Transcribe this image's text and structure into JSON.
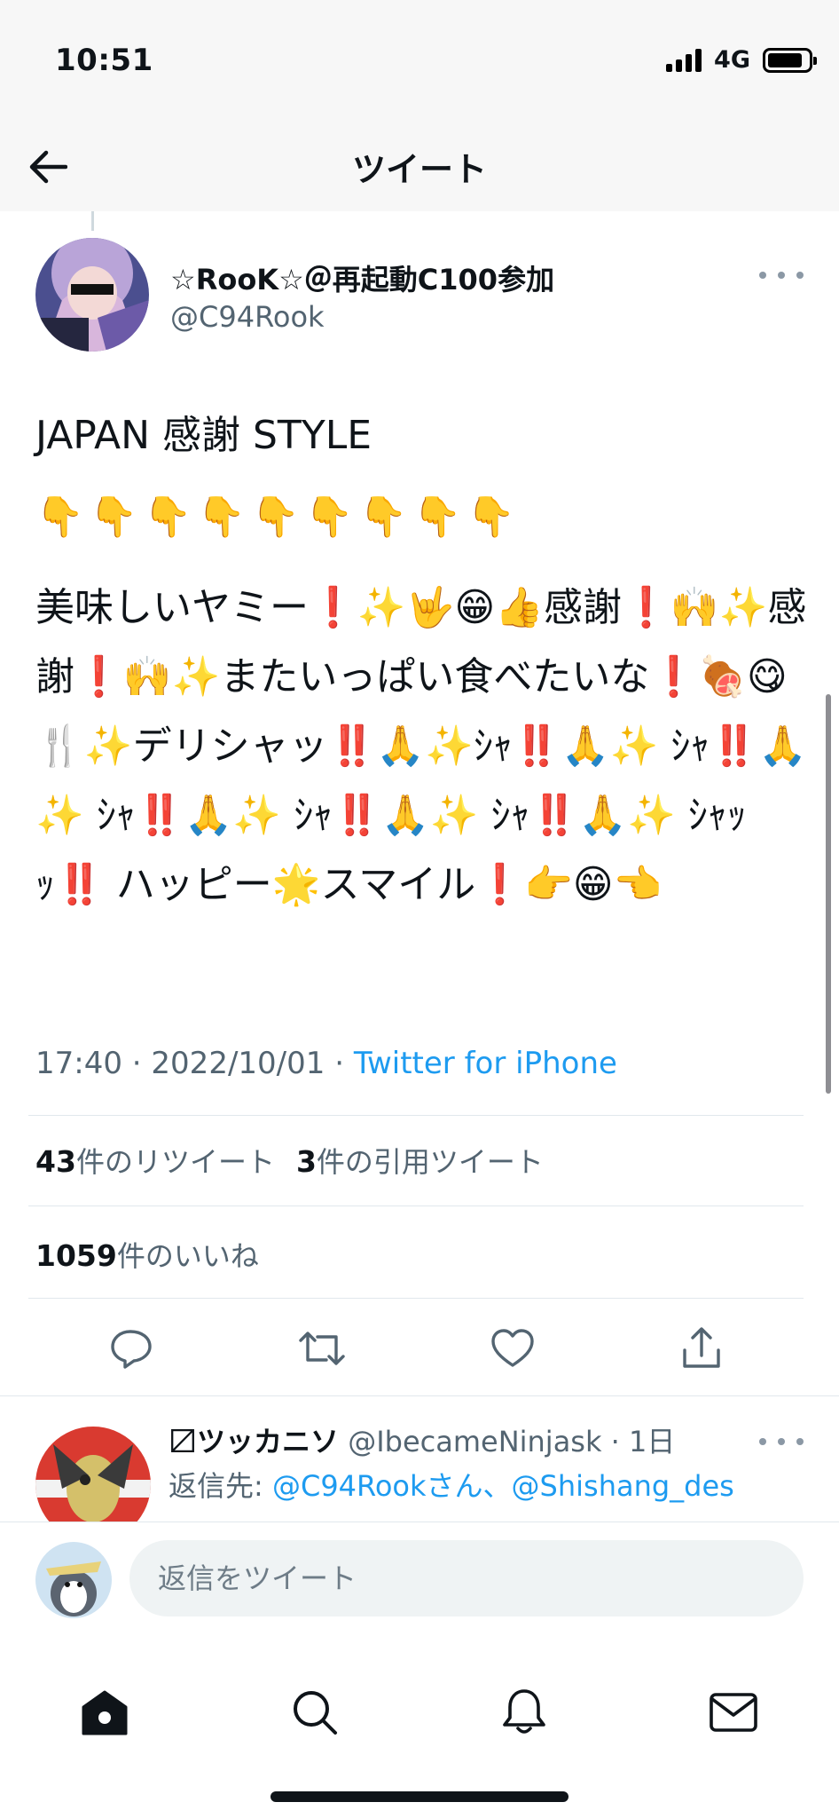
{
  "status_bar": {
    "time": "10:51",
    "network": "4G"
  },
  "header": {
    "title": "ツイート"
  },
  "tweet": {
    "display_name": "☆RooK☆＠再起動C100参加",
    "handle": "@C94Rook",
    "text_line1": "JAPAN 感謝 STYLE",
    "pointing_row": "👇👇👇👇👇👇👇👇👇",
    "body": "美味しいヤミー❗✨🤟😁👍感謝❗🙌✨感謝❗🙌✨またいっぱい食べたいな❗🍖😋🍴✨デリシャッ‼️🙏✨ｼｬ‼️🙏✨ ｼｬ‼️🙏✨ ｼｬ‼️🙏✨ ｼｬ‼️🙏✨ ｼｬ‼️🙏✨ ｼｬｯｯ‼️ ハッピー🌟スマイル❗👉😁👈",
    "time": "17:40",
    "date": "2022/10/01",
    "source": "Twitter for iPhone",
    "retweet_count": "43",
    "retweet_label": "件のリツイート",
    "quote_count": "3",
    "quote_label": "件の引用ツイート",
    "like_count": "1059",
    "like_label": "件のいいね"
  },
  "reply": {
    "name": "〼ツッカニソ",
    "handle": "@IbecameNinjask",
    "age": "1日",
    "reply_to_prefix": "返信先:",
    "mention1": "@C94Rook",
    "suffix1": "さん、",
    "mention2": "@Shishang_des"
  },
  "compose": {
    "placeholder": "返信をツイート"
  },
  "icons": {
    "back": "arrow-left-icon",
    "more": "more-dots-icon",
    "reply": "speech-bubble-icon",
    "retweet": "retweet-icon",
    "like": "heart-icon",
    "share": "share-icon",
    "home": "home-icon",
    "search": "search-icon",
    "notifications": "bell-icon",
    "messages": "envelope-icon"
  },
  "colors": {
    "link": "#1d9bf0",
    "secondary_text": "#536471",
    "primary_text": "#0f1419"
  }
}
